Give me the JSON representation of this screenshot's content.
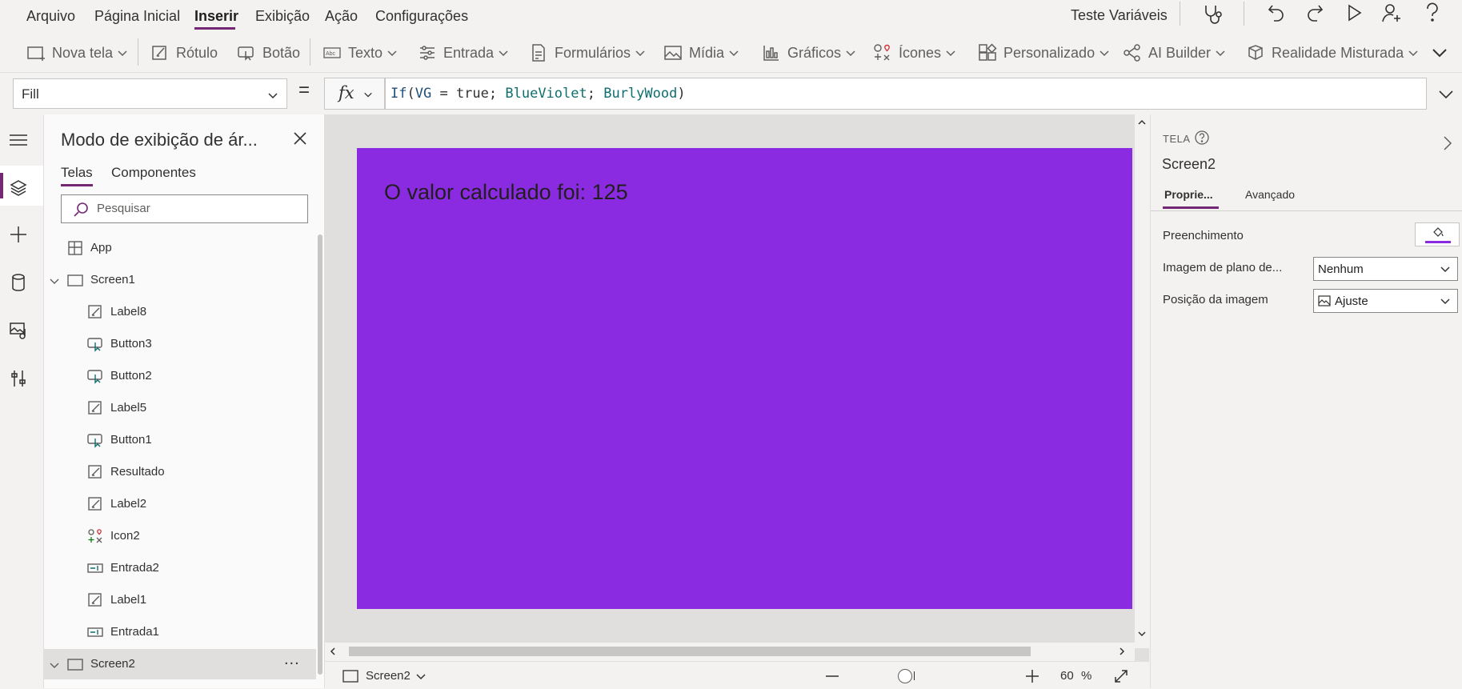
{
  "menu": {
    "items": [
      "Arquivo",
      "Página Inicial",
      "Inserir",
      "Exibição",
      "Ação",
      "Configurações"
    ],
    "active": "Inserir",
    "app_name": "Teste Variáveis"
  },
  "ribbon": {
    "nova_tela": "Nova tela",
    "rotulo": "Rótulo",
    "botao": "Botão",
    "texto": "Texto",
    "entrada": "Entrada",
    "formularios": "Formulários",
    "midia": "Mídia",
    "graficos": "Gráficos",
    "icones": "Ícones",
    "personalizado": "Personalizado",
    "ai_builder": "AI Builder",
    "realidade": "Realidade Misturada"
  },
  "formula_bar": {
    "property": "Fill",
    "equals": "=",
    "fx": "fx",
    "tokens": {
      "fn": "If",
      "open": "(",
      "var": "VG",
      "op": " = ",
      "val": "true",
      "sep1": "; ",
      "color1": "BlueViolet",
      "sep2": "; ",
      "color2": "BurlyWood",
      "close": ")"
    }
  },
  "tree": {
    "title": "Modo de exibição de ár...",
    "tabs": [
      "Telas",
      "Componentes"
    ],
    "search_placeholder": "Pesquisar",
    "items": [
      {
        "label": "App",
        "icon": "app-icon",
        "level": 0
      },
      {
        "label": "Screen1",
        "icon": "screen-icon",
        "level": 0
      },
      {
        "label": "Label8",
        "icon": "label-icon",
        "level": 1
      },
      {
        "label": "Button3",
        "icon": "button-icon",
        "level": 1
      },
      {
        "label": "Button2",
        "icon": "button-icon",
        "level": 1
      },
      {
        "label": "Label5",
        "icon": "label-icon",
        "level": 1
      },
      {
        "label": "Button1",
        "icon": "button-icon",
        "level": 1
      },
      {
        "label": "Resultado",
        "icon": "label-icon",
        "level": 1
      },
      {
        "label": "Label2",
        "icon": "label-icon",
        "level": 1
      },
      {
        "label": "Icon2",
        "icon": "icons-icon",
        "level": 1
      },
      {
        "label": "Entrada2",
        "icon": "input-icon",
        "level": 1
      },
      {
        "label": "Label1",
        "icon": "label-icon",
        "level": 1
      },
      {
        "label": "Entrada1",
        "icon": "input-icon",
        "level": 1
      },
      {
        "label": "Screen2",
        "icon": "screen-icon",
        "level": 0
      }
    ],
    "more": "..."
  },
  "canvas": {
    "label_text": "O valor calculado foi: 125",
    "screen_color": "#8a2be2"
  },
  "status": {
    "screen": "Screen2",
    "zoom": "60",
    "zoom_unit": "%"
  },
  "props": {
    "kind": "TELA",
    "name": "Screen2",
    "tabs": [
      "Proprie...",
      "Avançado"
    ],
    "fill_label": "Preenchimento",
    "bgimage_label": "Imagem de plano de...",
    "bgimage_value": "Nenhum",
    "imgpos_label": "Posição da imagem",
    "imgpos_value": "Ajuste",
    "fill_color": "#8a2be2"
  },
  "colors": {
    "accent": "#742774"
  }
}
